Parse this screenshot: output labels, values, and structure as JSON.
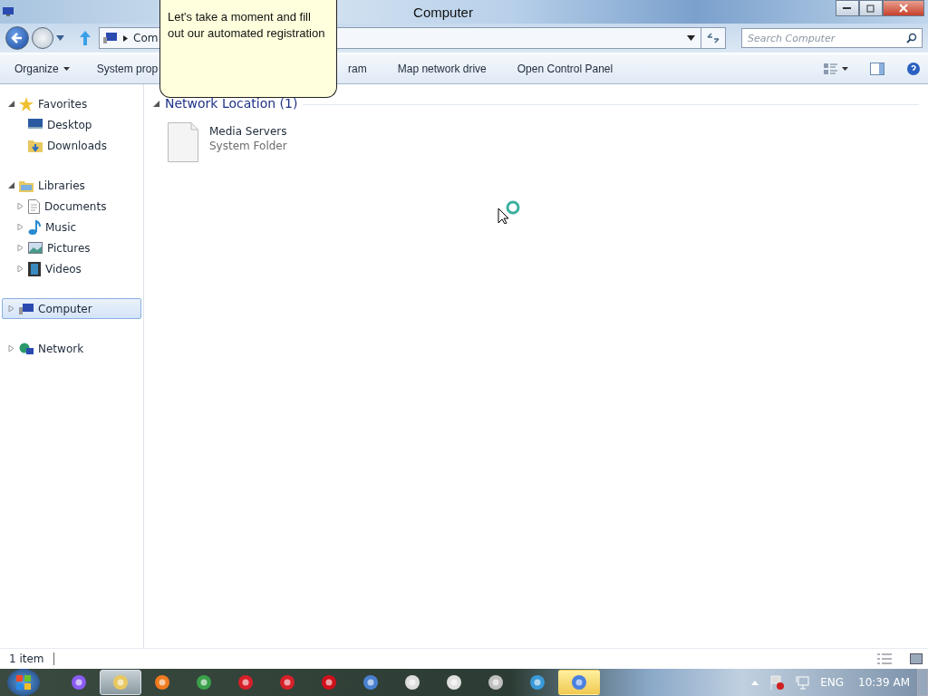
{
  "window": {
    "title": "Computer"
  },
  "address": {
    "crumbs": [
      "Com"
    ]
  },
  "search": {
    "placeholder": "Search Computer"
  },
  "toolbar": {
    "items": [
      {
        "label": "Organize",
        "dropdown": true
      },
      {
        "label": "System prop",
        "dropdown": false
      },
      {
        "label": "ram",
        "dropdown": false
      },
      {
        "label": "Map network drive",
        "dropdown": false
      },
      {
        "label": "Open Control Panel",
        "dropdown": false
      }
    ]
  },
  "sidebar": {
    "groups": [
      {
        "label": "Favorites",
        "expanded": true,
        "selected": false,
        "children": [
          {
            "label": "Desktop",
            "selected": false
          },
          {
            "label": "Downloads",
            "selected": false
          }
        ]
      },
      {
        "label": "Libraries",
        "expanded": true,
        "selected": false,
        "children": [
          {
            "label": "Documents",
            "expanded": false,
            "selected": false
          },
          {
            "label": "Music",
            "expanded": false,
            "selected": false
          },
          {
            "label": "Pictures",
            "expanded": false,
            "selected": false
          },
          {
            "label": "Videos",
            "expanded": false,
            "selected": false
          }
        ]
      },
      {
        "label": "Computer",
        "expanded": false,
        "selected": true
      },
      {
        "label": "Network",
        "expanded": false,
        "selected": false
      }
    ]
  },
  "content": {
    "group": "Network Location (1)",
    "items": [
      {
        "name": "Media Servers",
        "type": "System Folder"
      }
    ]
  },
  "callout": {
    "text": "Let's take a moment and fill out our automated registration"
  },
  "status_bar": {
    "text": "1 item"
  },
  "taskbar": {
    "apps": [
      {
        "active": false,
        "attention": false
      },
      {
        "active": true,
        "attention": false
      },
      {
        "active": false,
        "attention": false
      },
      {
        "active": false,
        "attention": false
      },
      {
        "active": false,
        "attention": false
      },
      {
        "active": false,
        "attention": false
      },
      {
        "active": false,
        "attention": false
      },
      {
        "active": false,
        "attention": false
      },
      {
        "active": false,
        "attention": false
      },
      {
        "active": false,
        "attention": false
      },
      {
        "active": false,
        "attention": false
      },
      {
        "active": false,
        "attention": false
      },
      {
        "active": false,
        "attention": true
      }
    ],
    "language": "ENG",
    "clock": "10:39 AM"
  }
}
